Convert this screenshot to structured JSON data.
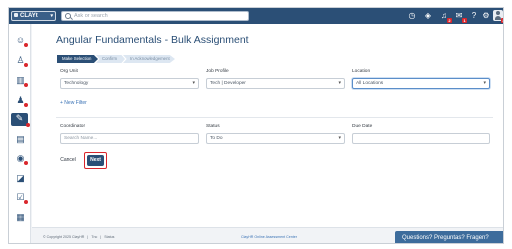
{
  "topbar": {
    "logo_text": "CLAYt",
    "search_placeholder": "Ask or search",
    "icons": [
      "clock-icon",
      "layers-icon",
      "bell-icon",
      "inbox-icon",
      "help-icon",
      "settings-icon"
    ],
    "notification_badge": "2",
    "inbox_badge": "1",
    "avatar_badge": "2"
  },
  "sidebar": {
    "items": [
      "users-icon",
      "user-clock-icon",
      "bar-chart-icon",
      "people-icon",
      "bulk-assign-icon",
      "document-icon",
      "search-icon",
      "report-icon",
      "tasks-icon",
      "clipboard-icon"
    ]
  },
  "page": {
    "title": "Angular Fundamentals - Bulk Assignment",
    "steps": [
      "Make Selection",
      "Confirm",
      "In Acknowledgement"
    ]
  },
  "filters": {
    "org_unit": {
      "label": "Org Unit",
      "value": "Technology"
    },
    "job_profile": {
      "label": "Job Profile",
      "value": "Tech | Developer"
    },
    "location": {
      "label": "Location",
      "value": "All Locations"
    },
    "new_filter": "+ New Filter"
  },
  "assignment": {
    "coordinator": {
      "label": "Coordinator",
      "placeholder": "Search Name..."
    },
    "status": {
      "label": "Status",
      "value": "To Do"
    },
    "due_date": {
      "label": "Due Date",
      "value": ""
    }
  },
  "actions": {
    "cancel_label": "Cancel",
    "next_label": "Next"
  },
  "footer": {
    "copyright": "© Copyright 2025 ClayHR",
    "terms": "Tnc",
    "status": "Status",
    "center_link": "ClayHR Online Assessment Center",
    "help_text": "Questions? Preguntas? Fragen?"
  },
  "colors": {
    "brand": "#2b4f76",
    "highlight": "#d9262c",
    "link": "#3b73b5"
  }
}
